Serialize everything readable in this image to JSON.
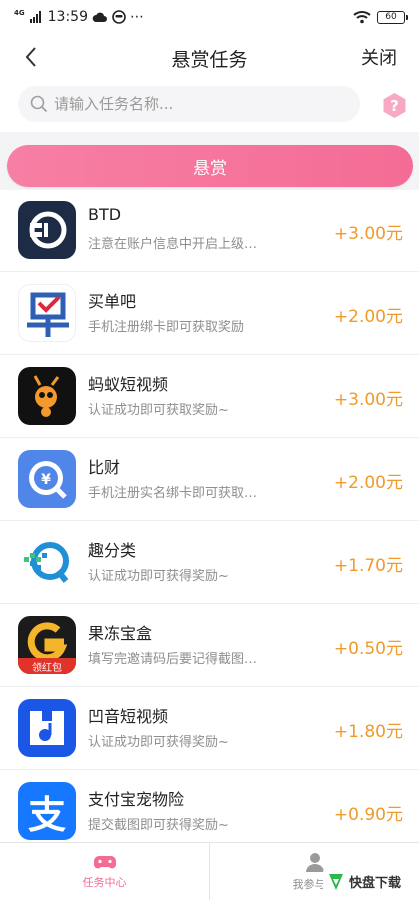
{
  "status": {
    "network": "4G",
    "time": "13:59",
    "extras": "⋯",
    "battery": "60"
  },
  "nav": {
    "title": "悬赏任务",
    "close_label": "关闭"
  },
  "search": {
    "placeholder": "请输入任务名称..."
  },
  "tab": {
    "label": "悬赏"
  },
  "tasks": [
    {
      "name": "BTD",
      "desc": "注意在账户信息中开启上级…",
      "reward": "+3.00元",
      "icon": "btd-icon"
    },
    {
      "name": "买单吧",
      "desc": "手机注册绑卡即可获取奖励",
      "reward": "+2.00元",
      "icon": "maidanba-icon"
    },
    {
      "name": "蚂蚁短视频",
      "desc": "认证成功即可获取奖励~",
      "reward": "+3.00元",
      "icon": "ant-video-icon"
    },
    {
      "name": "比财",
      "desc": "手机注册实名绑卡即可获取…",
      "reward": "+2.00元",
      "icon": "bicai-icon"
    },
    {
      "name": "趣分类",
      "desc": "认证成功即可获得奖励~",
      "reward": "+1.70元",
      "icon": "qufenlei-icon"
    },
    {
      "name": "果冻宝盒",
      "desc": "填写完邀请码后要记得截图…",
      "reward": "+0.50元",
      "icon": "guodong-icon",
      "badge": "领红包"
    },
    {
      "name": "凹音短视频",
      "desc": "认证成功即可获得奖励~",
      "reward": "+1.80元",
      "icon": "aoyin-icon"
    },
    {
      "name": "支付宝宠物险",
      "desc": "提交截图即可获得奖励~",
      "reward": "+0.90元",
      "icon": "alipay-icon",
      "glyph": "支"
    }
  ],
  "bottom_nav": {
    "items": [
      {
        "label": "任务中心",
        "icon": "gamepad-icon"
      },
      {
        "label": "我参与的",
        "icon": "user-icon"
      }
    ]
  },
  "watermark": {
    "text": "快盘下载"
  },
  "colors": {
    "accent": "#f46c95",
    "reward": "#f09a2b"
  }
}
